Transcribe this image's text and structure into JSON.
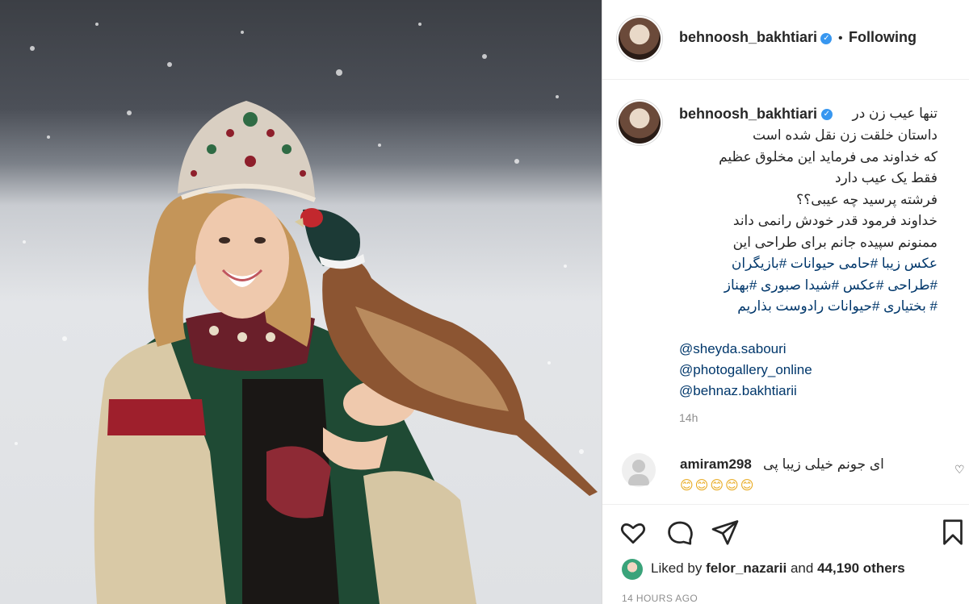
{
  "post": {
    "username": "behnoosh_bakhtiari",
    "follow_status": "Following",
    "caption_lines": [
      "تنها عیب زن در",
      "داستان خلقت زن نقل شده است",
      "که خداوند می فرماید این مخلوق عظیم",
      "فقط یک عیب دارد",
      "فرشته پرسید چه عیبی؟؟",
      "خداوند فرمود قدر خودش رانمی داند",
      "ممنونم سپیده جانم برای طراحی این",
      "عکس زیبا #حامی حیوانات #بازیگران",
      "#طراحی #عکس #شیدا صبوری #بهناز",
      "# بختیاری #حیوانات رادوست بذاریم"
    ],
    "mentions": [
      "@sheyda.sabouri",
      "@photogallery_online",
      "@behnaz.bakhtiarii"
    ],
    "time_short": "14h"
  },
  "comment": {
    "username": "amiram298",
    "text": "ای جونم خیلی زیبا پی",
    "emoji": "😊😊😊😊😊"
  },
  "likes": {
    "prefix": "Liked by",
    "user": "felor_nazarii",
    "middle": "and",
    "count": "44,190 others"
  },
  "posted_ago": "14 HOURS AGO",
  "icons": {
    "verified": "verified-badge-icon",
    "like": "heart-icon",
    "comment": "comment-bubble-icon",
    "share": "paper-plane-icon",
    "save": "bookmark-icon"
  },
  "colors": {
    "link": "#00376b",
    "verified": "#3897f0",
    "muted": "#8e8e8e"
  }
}
